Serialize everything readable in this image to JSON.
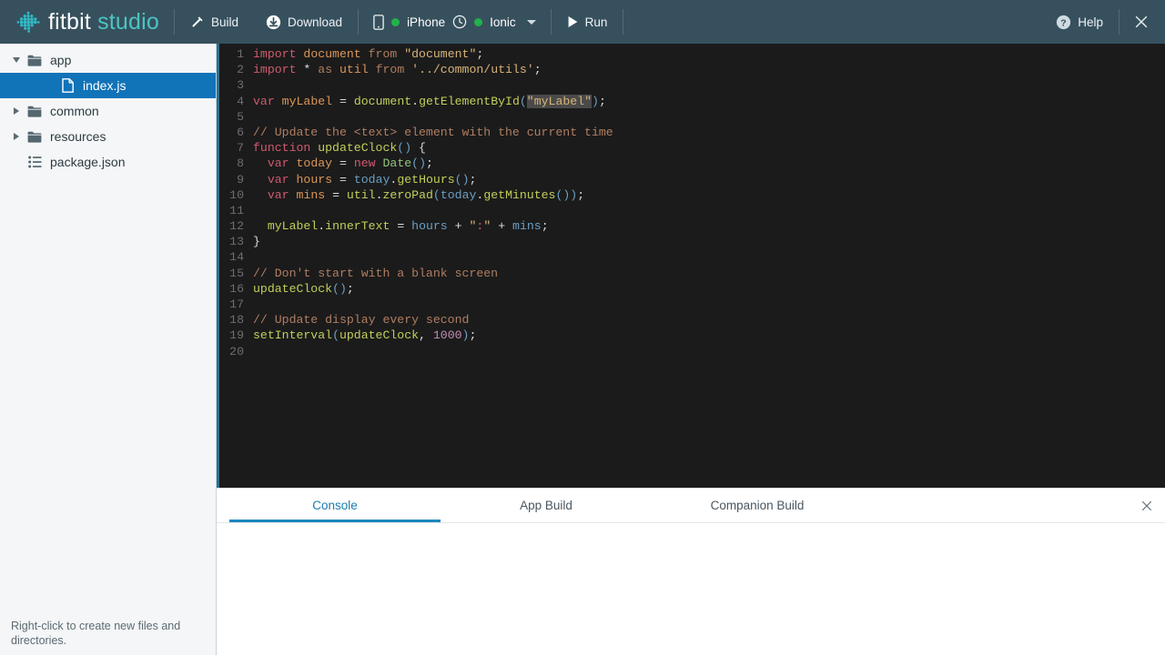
{
  "app": {
    "brand_primary": "fitbit",
    "brand_secondary": "studio",
    "brand_mark": "fitbit-dots-logo"
  },
  "colors": {
    "toolbar_bg": "#37505d",
    "brand_teal": "#4bc4c4",
    "sidebar_bg": "#f4f6f7",
    "selection_blue": "#1173b8",
    "tab_active_blue": "#1a7cb0",
    "editor_bg": "#1b1b1b",
    "status_green": "#21b24b"
  },
  "toolbar": {
    "build_label": "Build",
    "build_icon": "hammer-icon",
    "download_label": "Download",
    "download_icon": "download-circle-icon",
    "device_phone_icon": "phone-icon",
    "device_phone_label": "iPhone",
    "device_phone_status": "connected",
    "device_watch_icon": "clock-icon",
    "device_watch_label": "Ionic",
    "device_watch_status": "connected",
    "device_dropdown_icon": "chevron-down-icon",
    "run_label": "Run",
    "run_icon": "play-icon",
    "help_label": "Help",
    "help_icon": "question-circle-icon",
    "close_icon": "close-icon"
  },
  "sidebar": {
    "items": [
      {
        "label": "app",
        "type": "folder",
        "depth": 1,
        "expanded": true,
        "selected": false,
        "icon": "folder-icon",
        "twisty": "chevron-down-icon"
      },
      {
        "label": "index.js",
        "type": "file",
        "depth": 2,
        "expanded": null,
        "selected": true,
        "icon": "file-icon",
        "twisty": ""
      },
      {
        "label": "common",
        "type": "folder",
        "depth": 1,
        "expanded": false,
        "selected": false,
        "icon": "folder-icon",
        "twisty": "chevron-right-icon"
      },
      {
        "label": "resources",
        "type": "folder",
        "depth": 1,
        "expanded": false,
        "selected": false,
        "icon": "folder-icon",
        "twisty": "chevron-right-icon"
      },
      {
        "label": "package.json",
        "type": "file",
        "depth": 1,
        "expanded": null,
        "selected": false,
        "icon": "list-icon",
        "twisty": ""
      }
    ],
    "hint": "Right-click to create new files and directories."
  },
  "editor": {
    "filename": "index.js",
    "total_lines": 20,
    "lines": [
      {
        "n": 1,
        "html": "<span class=\"t-kw\">import</span> <span class=\"t-var\">document</span> <span class=\"t-com\">from</span> <span class=\"t-str\">\"document\"</span><span class=\"t-pun\">;</span>"
      },
      {
        "n": 2,
        "html": "<span class=\"t-kw\">import</span> <span class=\"t-pun\">*</span> <span class=\"t-com\">as</span> <span class=\"t-var\">util</span> <span class=\"t-com\">from</span> <span class=\"t-str\">'../common/utils'</span><span class=\"t-pun\">;</span>"
      },
      {
        "n": 3,
        "html": ""
      },
      {
        "n": 4,
        "html": "<span class=\"t-kw\">var</span> <span class=\"t-var\">myLabel</span> <span class=\"t-pun\">=</span> <span class=\"t-fn\">document</span><span class=\"t-pun\">.</span><span class=\"t-fn\">getElementById</span><span class=\"t-blu\">(</span><span class=\"t-str hl\">\"myLabel\"</span><span class=\"t-blu\">)</span><span class=\"t-pun\">;</span>"
      },
      {
        "n": 5,
        "html": ""
      },
      {
        "n": 6,
        "html": "<span class=\"t-com\">// Update the &lt;text&gt; element with the current time</span>"
      },
      {
        "n": 7,
        "html": "<span class=\"t-kw\">function</span> <span class=\"t-fn\">updateClock</span><span class=\"t-blu\">()</span> <span class=\"t-pun\">{</span>"
      },
      {
        "n": 8,
        "html": "  <span class=\"t-kw\">var</span> <span class=\"t-var\">today</span> <span class=\"t-pun\">=</span> <span class=\"t-kw\">new</span> <span class=\"t-gr\">Date</span><span class=\"t-blu\">()</span><span class=\"t-pun\">;</span>"
      },
      {
        "n": 9,
        "html": "  <span class=\"t-kw\">var</span> <span class=\"t-var\">hours</span> <span class=\"t-pun\">=</span> <span class=\"t-blu\">today</span><span class=\"t-pun\">.</span><span class=\"t-fn\">getHours</span><span class=\"t-blu\">()</span><span class=\"t-pun\">;</span>"
      },
      {
        "n": 10,
        "html": "  <span class=\"t-kw\">var</span> <span class=\"t-var\">mins</span> <span class=\"t-pun\">=</span> <span class=\"t-fn\">util</span><span class=\"t-pun\">.</span><span class=\"t-fn\">zeroPad</span><span class=\"t-blu\">(</span><span class=\"t-blu\">today</span><span class=\"t-pun\">.</span><span class=\"t-fn\">getMinutes</span><span class=\"t-blu\">())</span><span class=\"t-pun\">;</span>"
      },
      {
        "n": 11,
        "html": ""
      },
      {
        "n": 12,
        "html": "  <span class=\"t-fn\">myLabel</span><span class=\"t-pun\">.</span><span class=\"t-fn\">innerText</span> <span class=\"t-pun\">=</span> <span class=\"t-blu\">hours</span> <span class=\"t-pun\">+</span> <span class=\"t-str\">\"<span class=\"t-kw\">:</span>\"</span> <span class=\"t-pun\">+</span> <span class=\"t-blu\">mins</span><span class=\"t-pun\">;</span>"
      },
      {
        "n": 13,
        "html": "<span class=\"t-pun\">}</span>"
      },
      {
        "n": 14,
        "html": ""
      },
      {
        "n": 15,
        "html": "<span class=\"t-com\">// Don't start with a blank screen</span>"
      },
      {
        "n": 16,
        "html": "<span class=\"t-fn\">updateClock</span><span class=\"t-blu\">()</span><span class=\"t-pun\">;</span>"
      },
      {
        "n": 17,
        "html": ""
      },
      {
        "n": 18,
        "html": "<span class=\"t-com\">// Update display every second</span>"
      },
      {
        "n": 19,
        "html": "<span class=\"t-fn\">setInterval</span><span class=\"t-blu\">(</span><span class=\"t-fn\">updateClock</span><span class=\"t-pun\">,</span> <span class=\"t-num\">1000</span><span class=\"t-blu\">)</span><span class=\"t-pun\">;</span>"
      },
      {
        "n": 20,
        "html": ""
      }
    ],
    "plain_text": "import document from \"document\";\nimport * as util from '../common/utils';\n\nvar myLabel = document.getElementById(\"myLabel\");\n\n// Update the <text> element with the current time\nfunction updateClock() {\n  var today = new Date();\n  var hours = today.getHours();\n  var mins = util.zeroPad(today.getMinutes());\n\n  myLabel.innerText = hours + \":\" + mins;\n}\n\n// Don't start with a blank screen\nupdateClock();\n\n// Update display every second\nsetInterval(updateClock, 1000);\n"
  },
  "console": {
    "tabs": [
      {
        "label": "Console",
        "active": true
      },
      {
        "label": "App Build",
        "active": false
      },
      {
        "label": "Companion Build",
        "active": false
      }
    ],
    "close_icon": "close-icon",
    "output": ""
  }
}
